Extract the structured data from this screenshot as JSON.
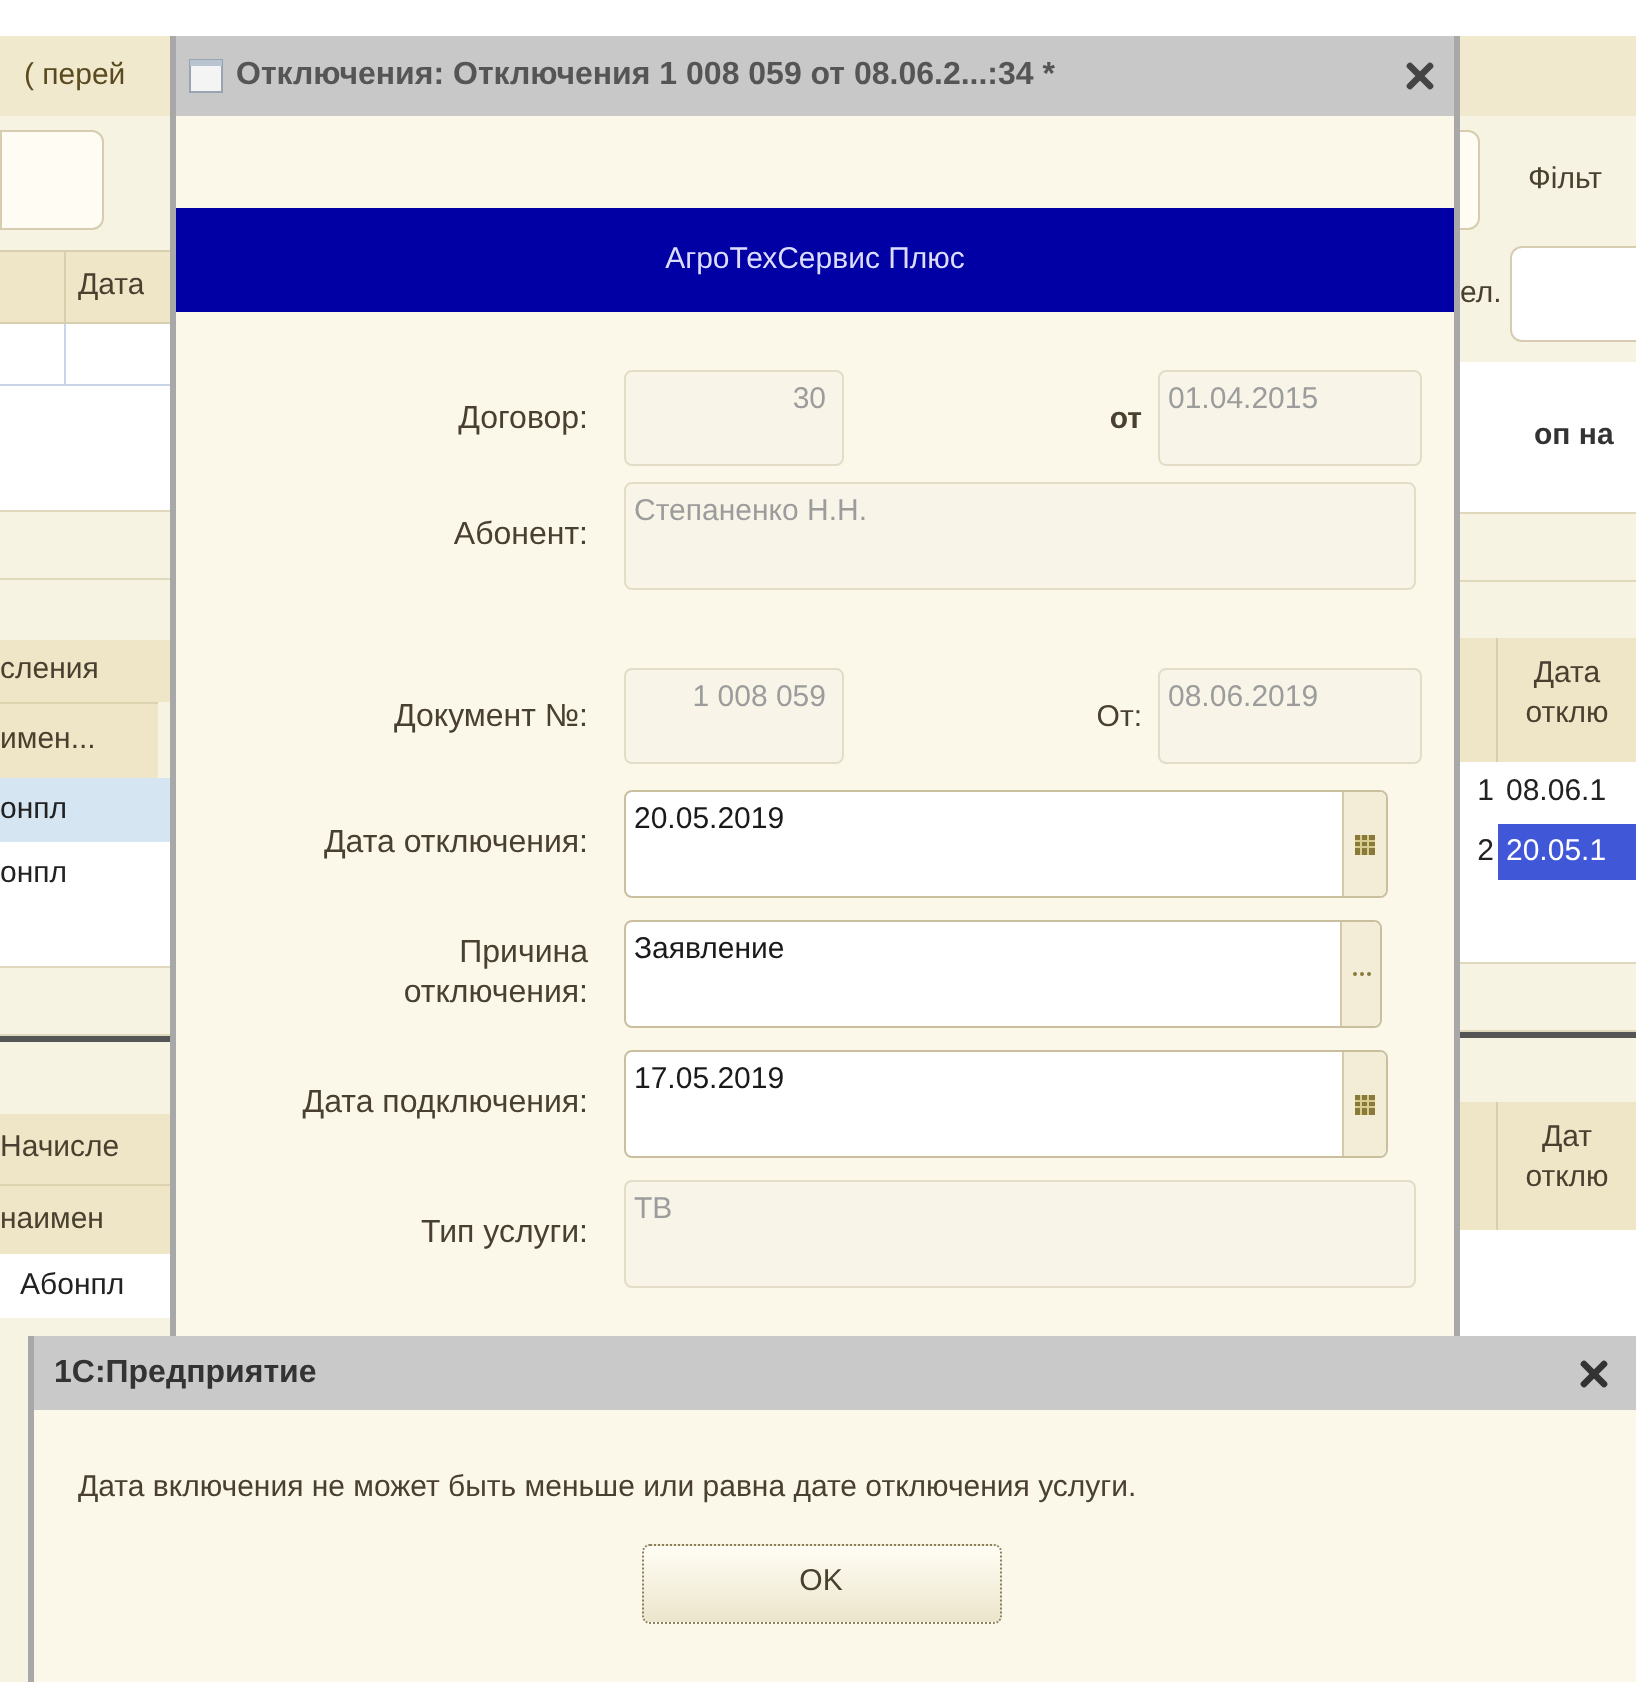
{
  "background_form": {
    "title_fragment": "( перей",
    "left": {
      "table1_header": "Дата",
      "table2_group": "сления",
      "table2_column": "имен...",
      "table2_rows": [
        {
          "text": "онпл",
          "selected": true
        },
        {
          "text": "онпл",
          "selected": false
        }
      ],
      "table3_group": "Начисле",
      "table3_column": "наимен",
      "table3_rows": [
        {
          "text": "Абонпл",
          "selected": false
        }
      ]
    },
    "right": {
      "filter_label": "Фільт",
      "field_label": "ел.",
      "section_label": "оп на",
      "table_header": "Дата отклю",
      "table_rows": [
        {
          "num": "1",
          "date": "08.06.1",
          "selected": false
        },
        {
          "num": "2",
          "date": "20.05.1",
          "selected": true
        }
      ],
      "table2_header": "Дат отклю"
    }
  },
  "document_window": {
    "title": "Отключения: Отключения 1 008 059 от 08.06.2...:34 *",
    "banner": "АгроТехСервис Плюс",
    "fields": [
      {
        "kind": "pair",
        "label": "Договор:",
        "value": "30",
        "disabled": true,
        "second_label": "от",
        "second_value": "01.04.2015"
      },
      {
        "kind": "text",
        "label": "Абонент:",
        "value": "Степаненко Н.Н.",
        "disabled": true
      },
      {
        "kind": "pair",
        "label": "Документ №:",
        "value": "1 008 059",
        "disabled": true,
        "second_label": "От:",
        "second_value": "08.06.2019"
      },
      {
        "kind": "date",
        "label": "Дата отключения:",
        "value": "20.05.2019",
        "disabled": false
      },
      {
        "kind": "choice",
        "label": "Причина отключения:",
        "value": "Заявление",
        "disabled": false
      },
      {
        "kind": "date",
        "label": "Дата подключения:",
        "value": "17.05.2019",
        "disabled": false
      },
      {
        "kind": "text",
        "label": "Тип услуги:",
        "value": "ТВ",
        "disabled": true
      }
    ]
  },
  "message_box": {
    "title": "1С:Предприятие",
    "message": "Дата включения не может быть меньше или равна дате отключения услуги.",
    "buttons": [
      "OK"
    ]
  }
}
